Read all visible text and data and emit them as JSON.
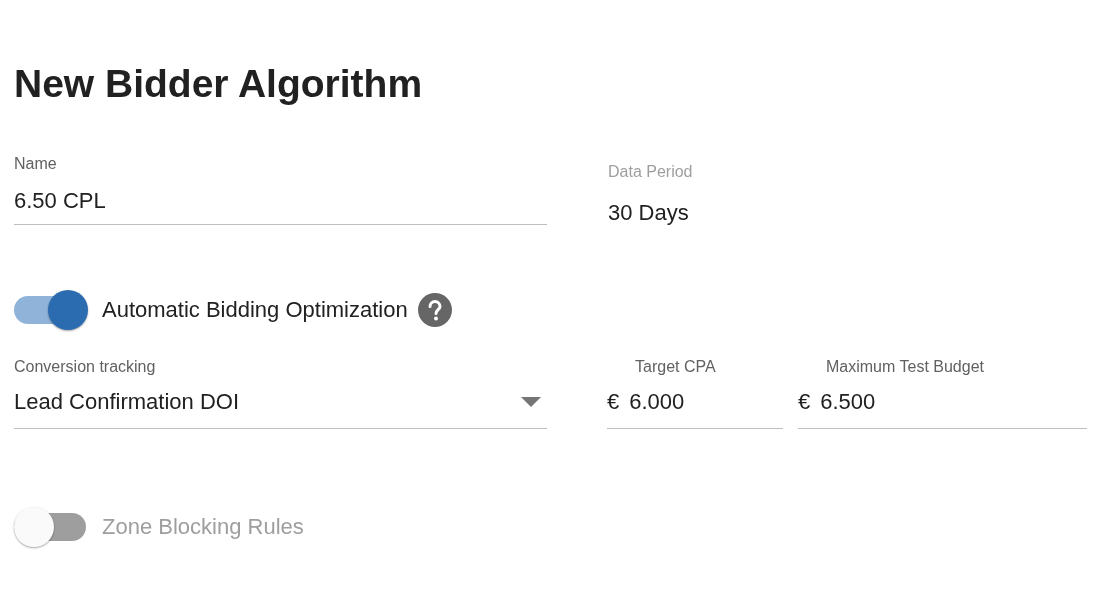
{
  "title": "New Bidder Algorithm",
  "name_field": {
    "label": "Name",
    "value": "6.50 CPL"
  },
  "data_period": {
    "label": "Data Period",
    "value": "30 Days"
  },
  "toggles": [
    {
      "label": "Automatic Bidding Optimization",
      "on": true,
      "help": true
    },
    {
      "label": "Zone Blocking Rules",
      "on": false,
      "help": false
    }
  ],
  "conversion_tracking": {
    "label": "Conversion tracking",
    "value": "Lead Confirmation DOI"
  },
  "money_fields": [
    {
      "label": "Target CPA",
      "prefix": "€",
      "value": "6.000"
    },
    {
      "label": "Maximum Test Budget",
      "prefix": "€",
      "value": "6.500"
    }
  ]
}
